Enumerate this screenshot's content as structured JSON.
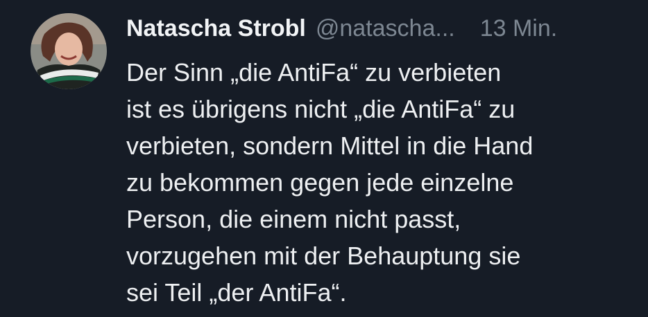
{
  "tweet": {
    "author_name": "Natascha Strobl",
    "handle": "@natascha...",
    "time": "13 Min.",
    "avatar_icon": "profile-photo",
    "lines": [
      "Der Sinn „die AntiFa“ zu verbieten",
      "ist es übrigens nicht „die AntiFa“ zu",
      "verbieten, sondern Mittel in die Hand",
      "zu bekommen gegen jede einzelne",
      "Person, die einem nicht passt,",
      "vorzugehen mit der Behauptung sie",
      "sei Teil „der AntiFa“."
    ]
  },
  "colors": {
    "background": "#161c26",
    "text": "#eef0f2",
    "muted": "#7d8792"
  }
}
